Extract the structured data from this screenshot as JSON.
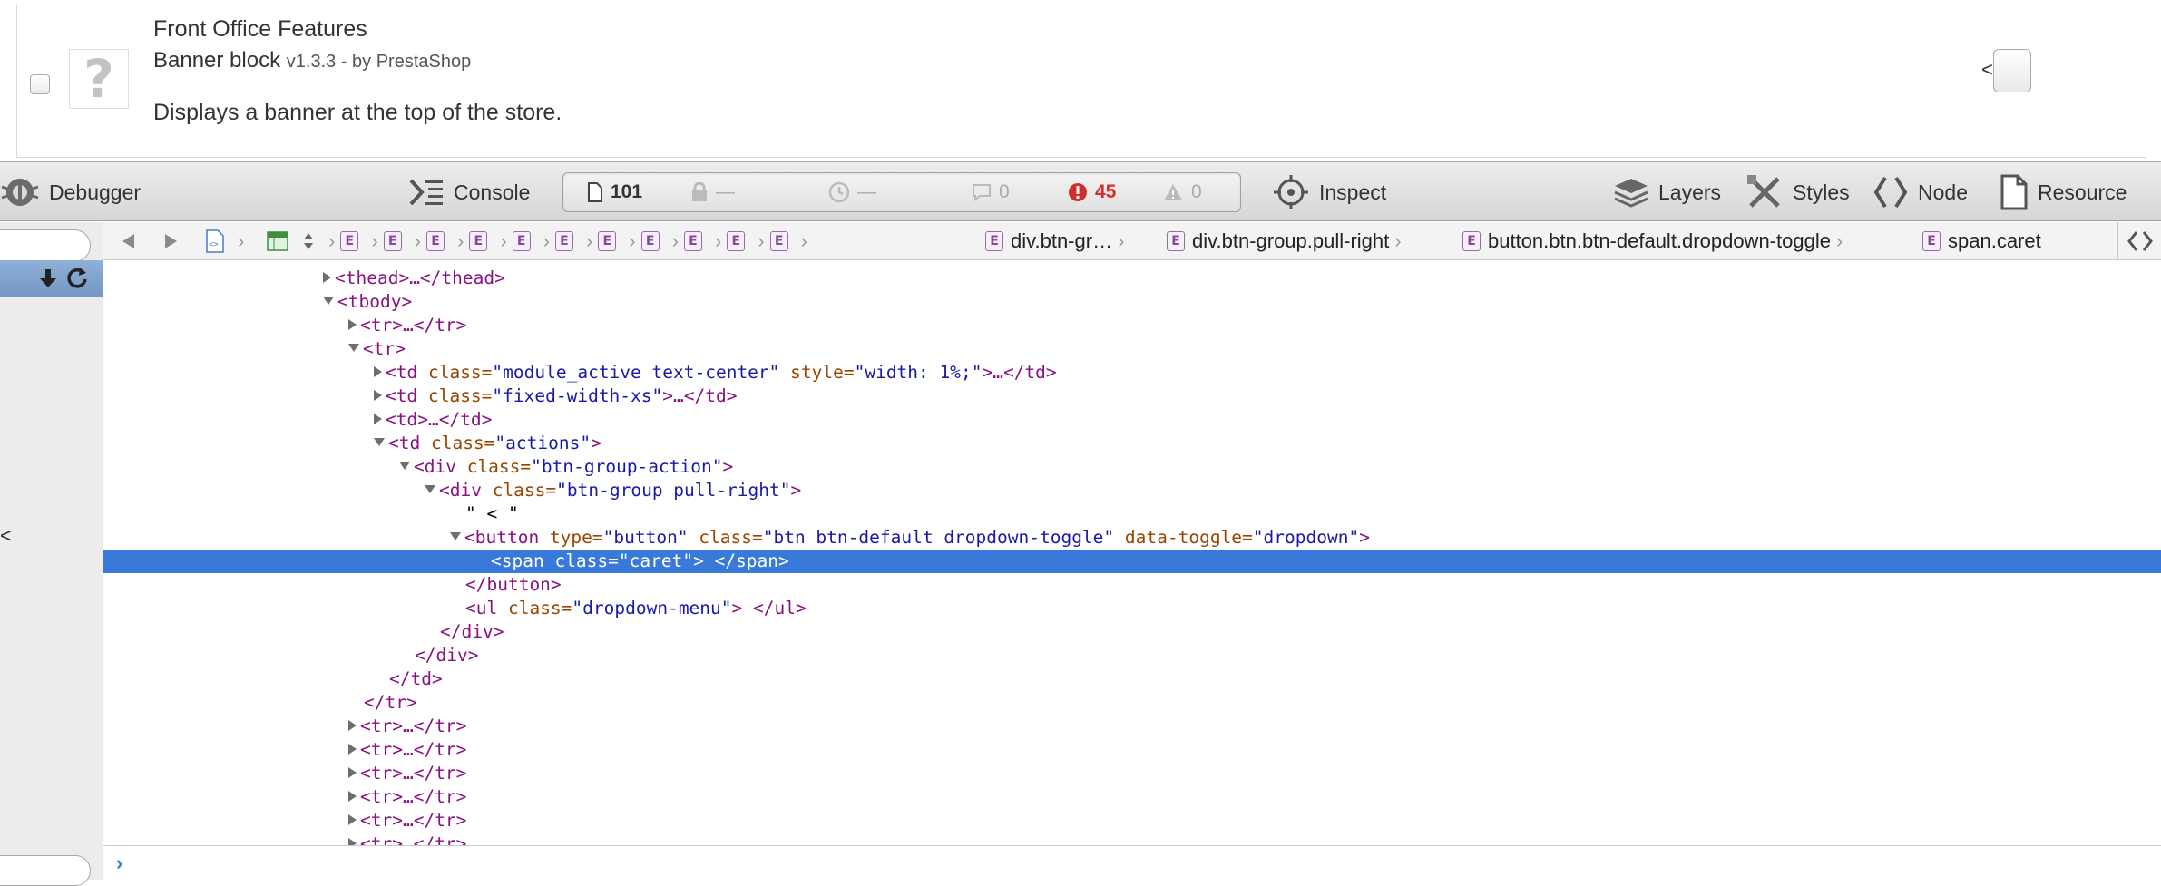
{
  "module": {
    "category": "Front Office Features",
    "name": "Banner block",
    "version": "v1.3.3 - by PrestaShop",
    "description": "Displays a banner at the top of the store.",
    "action_prefix": "<",
    "logo_glyph": "?"
  },
  "toolbar": {
    "debugger": "Debugger",
    "console": "Console",
    "inspect": "Inspect",
    "layers": "Layers",
    "styles": "Styles",
    "node": "Node",
    "resource": "Resource"
  },
  "activity": {
    "resources": "101",
    "locked": "—",
    "time": "—",
    "logs": "0",
    "errors": "45",
    "warnings": "0",
    "error_color": "#d12f2f"
  },
  "sidebar": {
    "fragment": "<"
  },
  "breadcrumb": {
    "badge": "E",
    "items": [
      "div.btn-gr…",
      "div.btn-group.pull-right",
      "button.btn.btn-default.dropdown-toggle",
      "span.caret"
    ]
  },
  "dom": {
    "selected_color": "#3879d9",
    "thead_open": "<thead>",
    "thead_close": "…</thead>",
    "tbody_open": "<tbody>",
    "tr_collapsed_open": "<tr>",
    "tr_collapsed_close": "…</tr>",
    "tr_open": "<tr>",
    "td1_open": "<td ",
    "td1_attr1": "class=",
    "td1_val1": "\"module_active text-center\"",
    "td1_attr2": " style=",
    "td1_val2": "\"width: 1%;\"",
    "td1_close": ">…</td>",
    "td2_open": "<td ",
    "td2_attr": "class=",
    "td2_val": "\"fixed-width-xs\"",
    "td2_close": ">…</td>",
    "td3": "<td>…</td>",
    "td4_open": "<td ",
    "td4_attr": "class=",
    "td4_val": "\"actions\"",
    "td4_close": ">",
    "div1_open": "<div ",
    "div1_attr": "class=",
    "div1_val": "\"btn-group-action\"",
    "div1_close": ">",
    "div2_open": "<div ",
    "div2_attr": "class=",
    "div2_val": "\"btn-group pull-right\"",
    "div2_close": ">",
    "text_node": "\" < \"",
    "button_open": "<button ",
    "button_attr1": "type=",
    "button_val1": "\"button\"",
    "button_attr2": " class=",
    "button_val2": "\"btn btn-default dropdown-toggle\"",
    "button_attr3": " data-toggle=",
    "button_val3": "\"dropdown\"",
    "button_close": ">",
    "span_open": "<span ",
    "span_attr": "class=",
    "span_val": "\"caret\"",
    "span_close": "> </span>",
    "button_end": "</button>",
    "ul_open": "<ul ",
    "ul_attr": "class=",
    "ul_val": "\"dropdown-menu\"",
    "ul_close": "> </ul>",
    "div_end": "</div>",
    "td_end": "</td>",
    "tr_end": "</tr>"
  }
}
